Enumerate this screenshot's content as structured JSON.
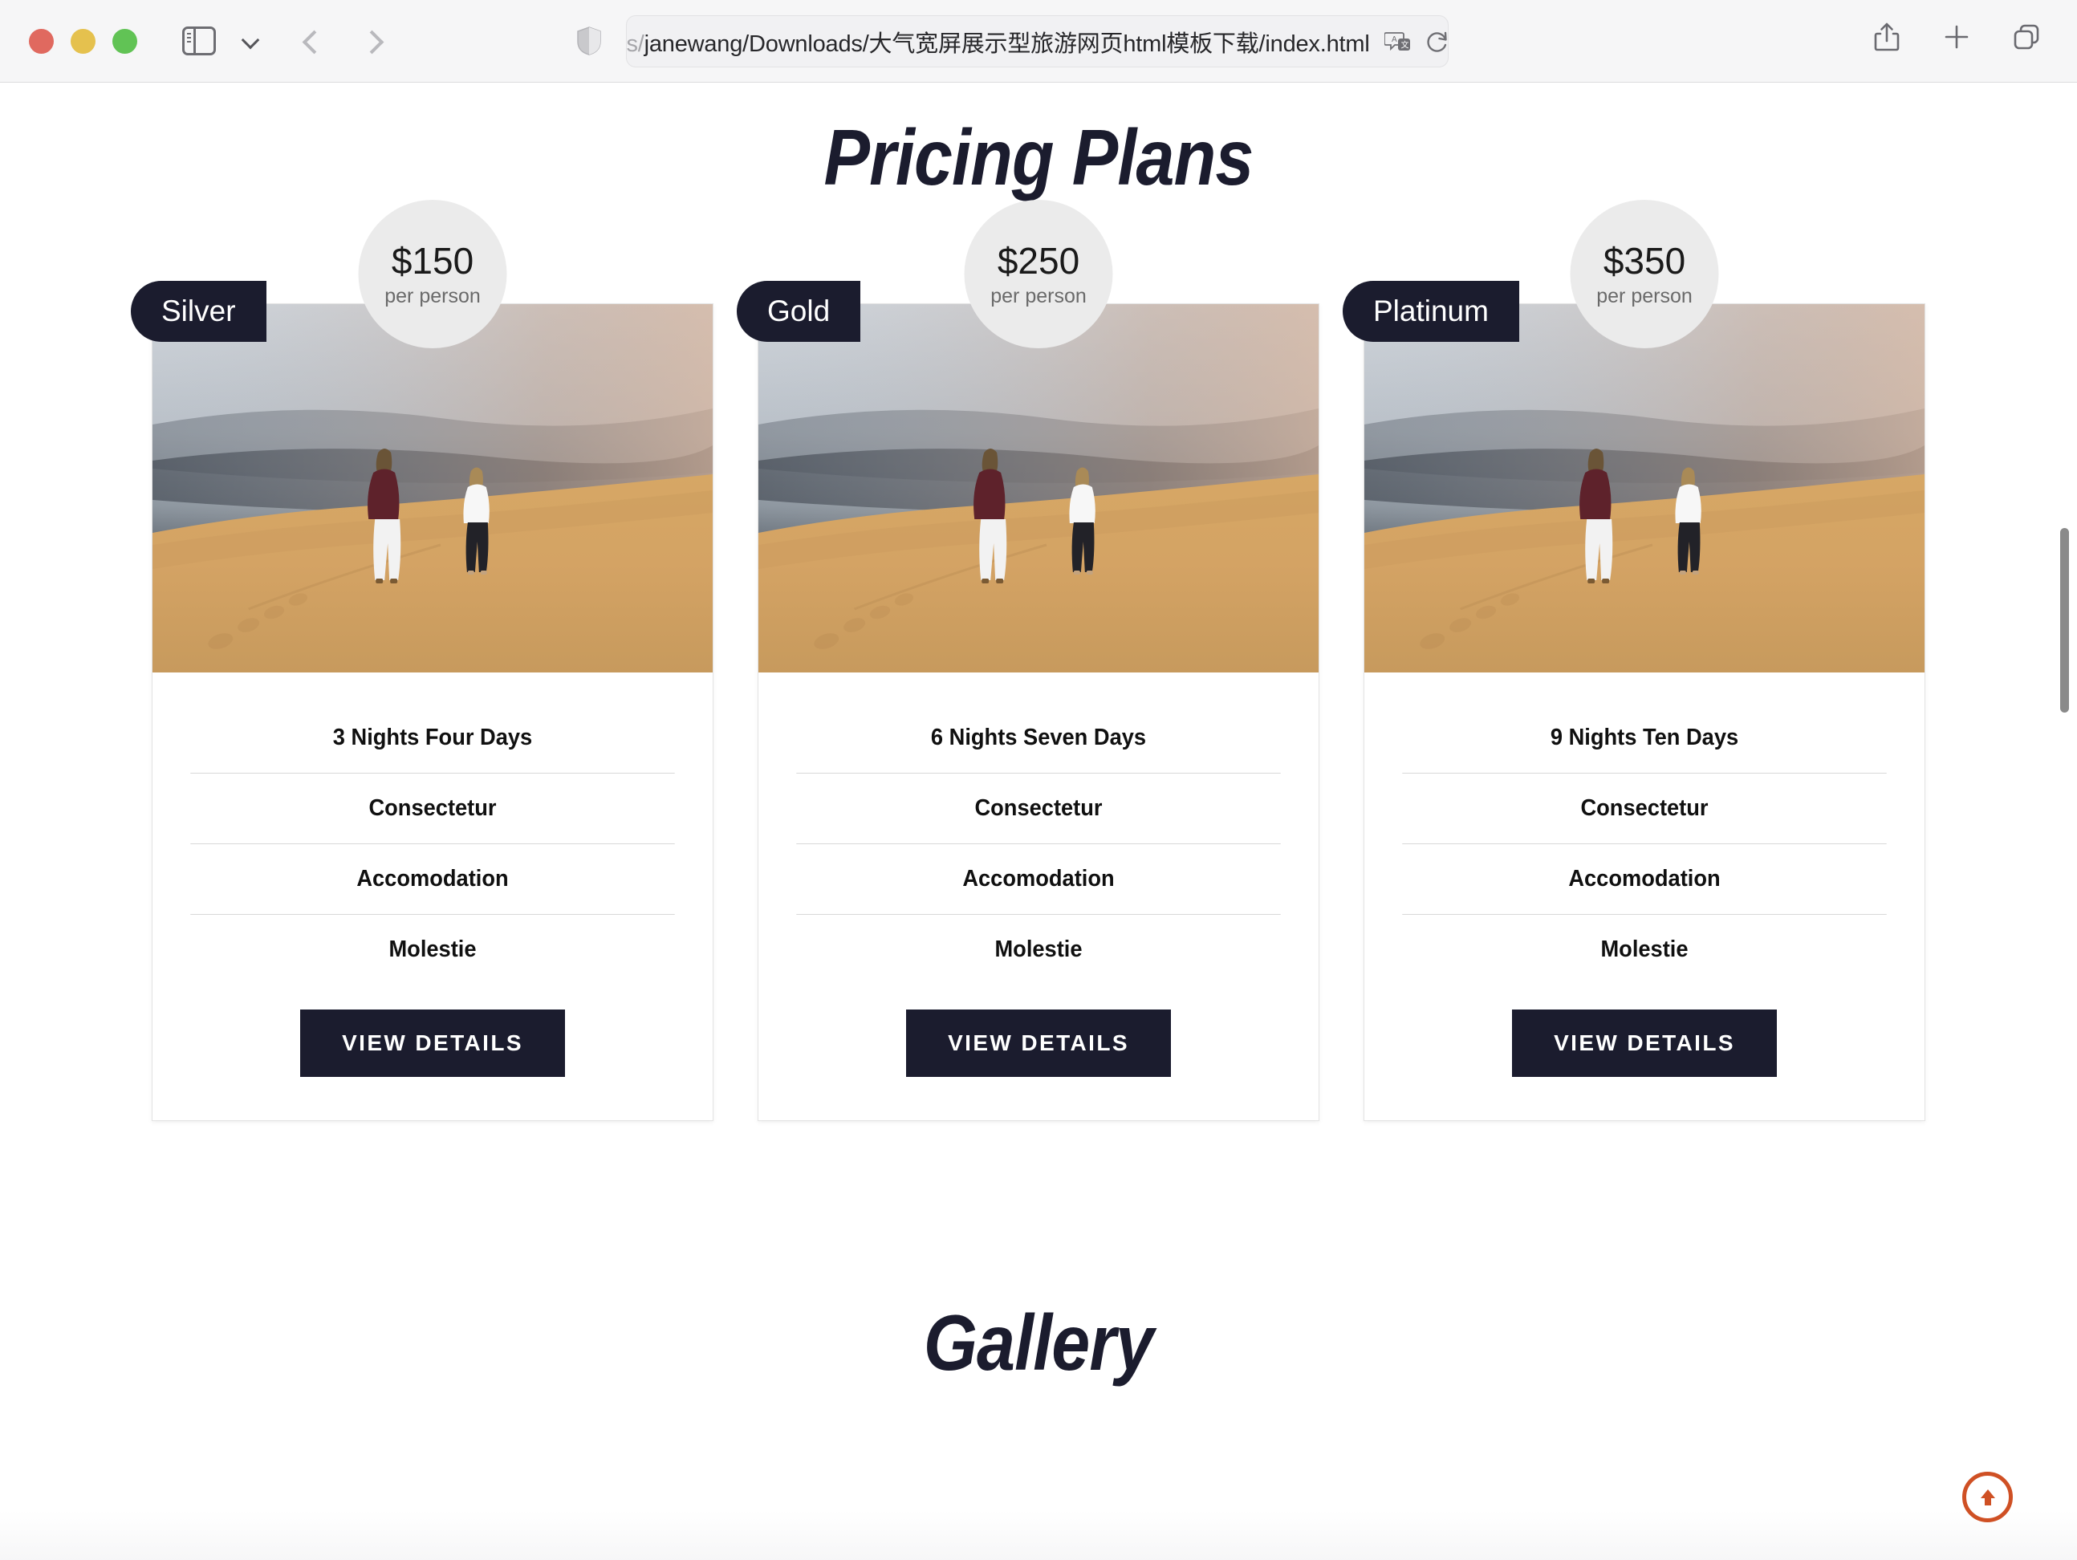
{
  "browser": {
    "url_prefix": "s/",
    "url_text": "janewang/Downloads/大气宽屏展示型旅游网页html模板下载/index.html",
    "icons": {
      "sidebar": "sidebar-toggle-icon",
      "chevron": "chevron-down-icon",
      "back": "back-arrow-icon",
      "forward": "forward-arrow-icon",
      "shield": "shield-icon",
      "translate": "translate-icon",
      "reload": "reload-icon",
      "share": "share-icon",
      "new_tab": "plus-icon",
      "tab_overview": "tab-overview-icon"
    }
  },
  "page": {
    "pricing_title": "Pricing Plans",
    "gallery_title": "Gallery",
    "scroll_top_label": "scroll-to-top",
    "accent_color": "#cf5024",
    "dark_color": "#1b1c2e",
    "bubble_color": "#ebebeb",
    "plans": [
      {
        "badge": "Silver",
        "price": "$150",
        "unit": "per person",
        "features": [
          "3 Nights Four Days",
          "Consectetur",
          "Accomodation",
          "Molestie"
        ],
        "cta": "VIEW DETAILS"
      },
      {
        "badge": "Gold",
        "price": "$250",
        "unit": "per person",
        "features": [
          "6 Nights Seven Days",
          "Consectetur",
          "Accomodation",
          "Molestie"
        ],
        "cta": "VIEW DETAILS"
      },
      {
        "badge": "Platinum",
        "price": "$350",
        "unit": "per person",
        "features": [
          "9 Nights Ten Days",
          "Consectetur",
          "Accomodation",
          "Molestie"
        ],
        "cta": "VIEW DETAILS"
      }
    ]
  }
}
